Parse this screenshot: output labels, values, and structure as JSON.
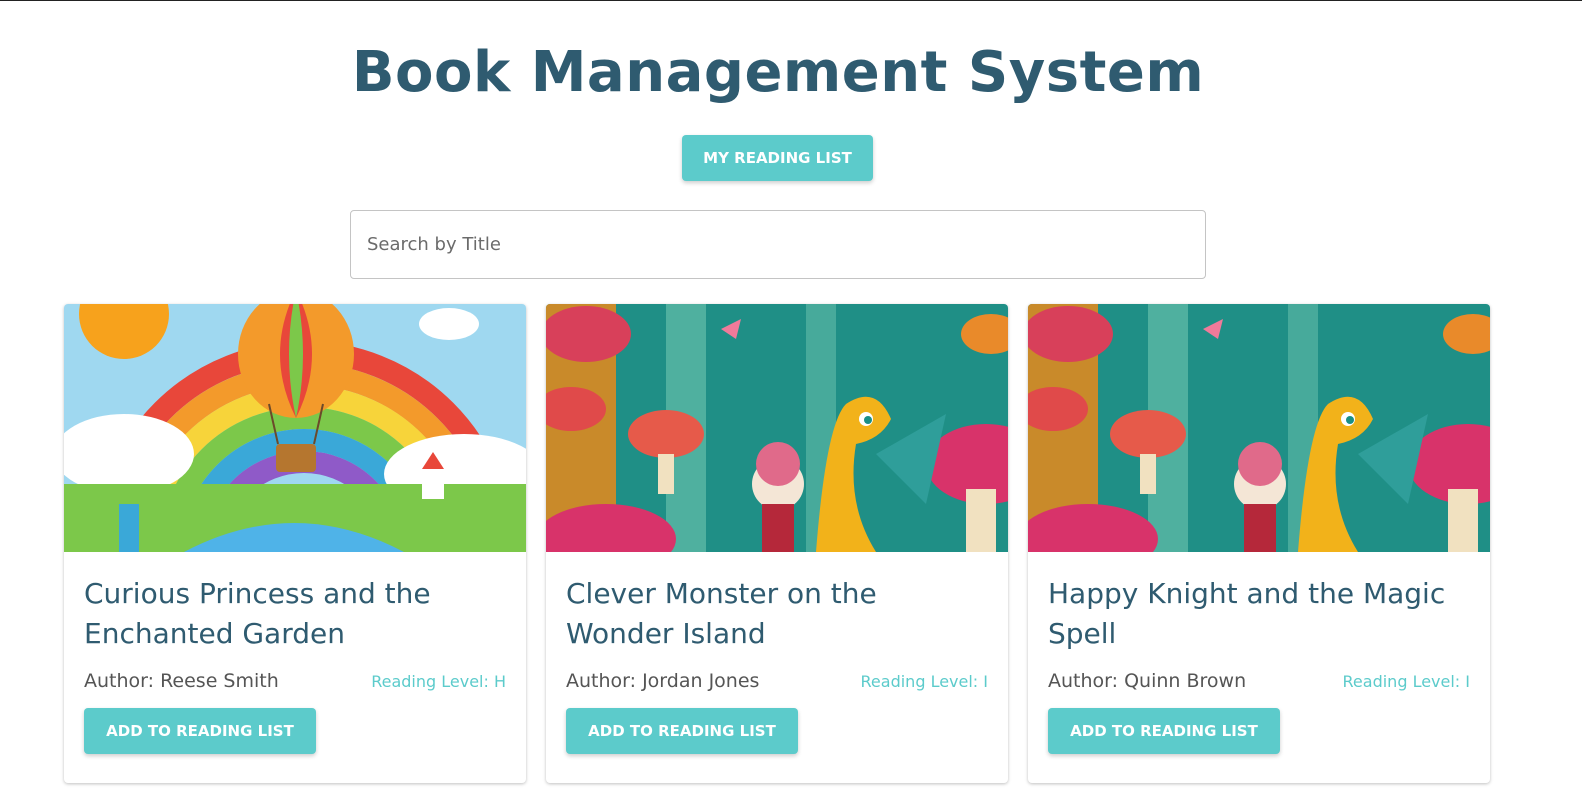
{
  "header": {
    "title": "Book Management System"
  },
  "toolbar": {
    "reading_list_label": "MY READING LIST"
  },
  "search": {
    "placeholder": "Search by Title",
    "value": ""
  },
  "books": [
    {
      "title": "Curious Princess and the Enchanted Garden",
      "author": "Author: Reese Smith",
      "level": "Reading Level: H",
      "button": "ADD TO READING LIST",
      "cover": "hot-air-balloon-rainbow-cover"
    },
    {
      "title": "Clever Monster on the Wonder Island",
      "author": "Author: Jordan Jones",
      "level": "Reading Level: I",
      "button": "ADD TO READING LIST",
      "cover": "dragon-mushroom-forest-cover"
    },
    {
      "title": "Happy Knight and the Magic Spell",
      "author": "Author: Quinn Brown",
      "level": "Reading Level: I",
      "button": "ADD TO READING LIST",
      "cover": "dragon-mushroom-forest-cover"
    }
  ],
  "colors": {
    "accent": "#5ccbcb",
    "title": "#2f5b70"
  }
}
